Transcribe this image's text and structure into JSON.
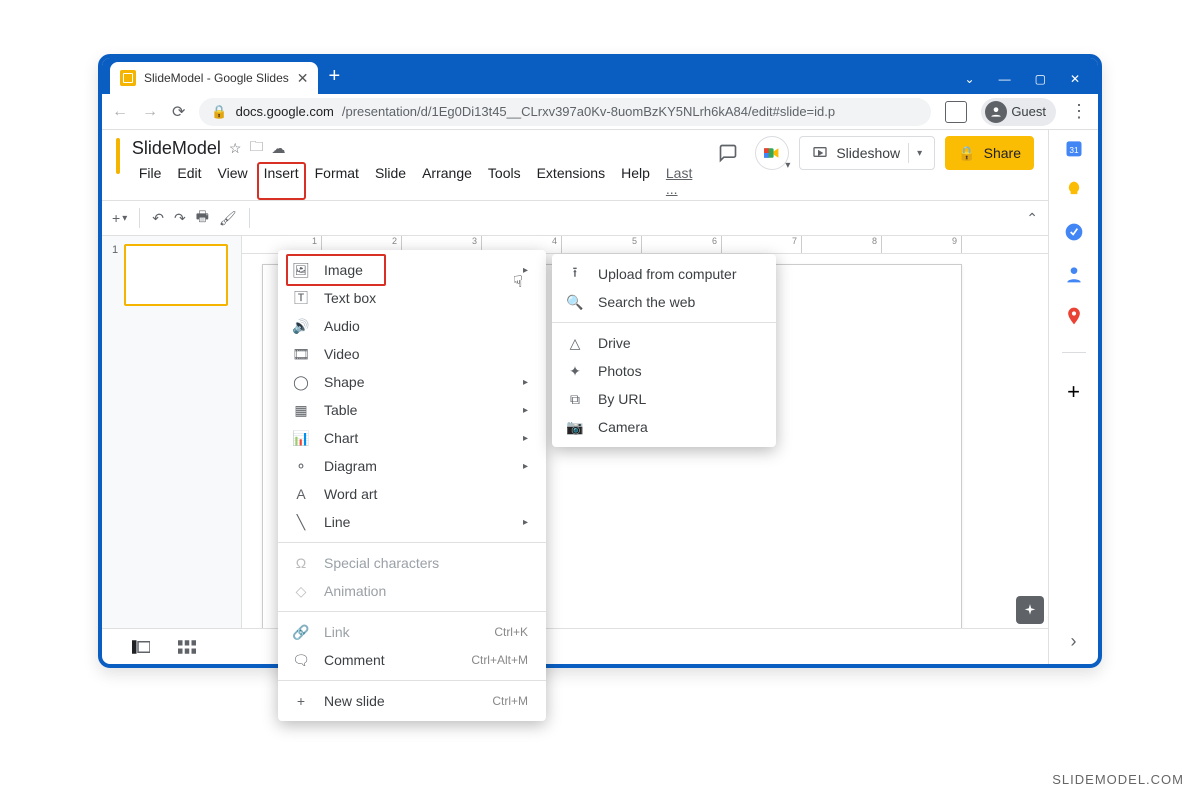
{
  "browser": {
    "tab_title": "SlideModel - Google Slides",
    "url_prefix": "docs.google.com",
    "url_path": "/presentation/d/1Eg0Di13t45__CLrxv397a0Kv-8uomBzKY5NLrh6kA84/edit#slide=id.p",
    "guest_label": "Guest"
  },
  "doc": {
    "title": "SlideModel",
    "menus": [
      "File",
      "Edit",
      "View",
      "Insert",
      "Format",
      "Slide",
      "Arrange",
      "Tools",
      "Extensions",
      "Help",
      "Last ..."
    ],
    "highlighted_menu": "Insert",
    "slideshow_label": "Slideshow",
    "share_label": "Share"
  },
  "ruler": [
    "1",
    "2",
    "3",
    "4",
    "5",
    "6",
    "7",
    "8",
    "9"
  ],
  "filmstrip": {
    "slide_number": "1"
  },
  "insert_menu": [
    {
      "icon": "image",
      "label": "Image",
      "arrow": true,
      "hl": true
    },
    {
      "icon": "textbox",
      "label": "Text box"
    },
    {
      "icon": "audio",
      "label": "Audio"
    },
    {
      "icon": "video",
      "label": "Video"
    },
    {
      "icon": "shape",
      "label": "Shape",
      "arrow": true
    },
    {
      "icon": "table",
      "label": "Table",
      "arrow": true
    },
    {
      "icon": "chart",
      "label": "Chart",
      "arrow": true
    },
    {
      "icon": "diagram",
      "label": "Diagram",
      "arrow": true
    },
    {
      "icon": "wordart",
      "label": "Word art"
    },
    {
      "icon": "line",
      "label": "Line",
      "arrow": true
    },
    {
      "sep": true
    },
    {
      "icon": "omega",
      "label": "Special characters",
      "dim": true
    },
    {
      "icon": "anim",
      "label": "Animation",
      "dim": true
    },
    {
      "sep": true
    },
    {
      "icon": "link",
      "label": "Link",
      "short": "Ctrl+K",
      "dim": true
    },
    {
      "icon": "comment",
      "label": "Comment",
      "short": "Ctrl+Alt+M"
    },
    {
      "sep": true
    },
    {
      "icon": "plus",
      "label": "New slide",
      "short": "Ctrl+M"
    }
  ],
  "image_submenu": [
    {
      "icon": "upload",
      "label": "Upload from computer"
    },
    {
      "icon": "search",
      "label": "Search the web"
    },
    {
      "sep": true
    },
    {
      "icon": "drive",
      "label": "Drive"
    },
    {
      "icon": "photos",
      "label": "Photos"
    },
    {
      "icon": "url",
      "label": "By URL"
    },
    {
      "icon": "camera",
      "label": "Camera"
    }
  ],
  "watermark": "SLIDEMODEL.COM"
}
